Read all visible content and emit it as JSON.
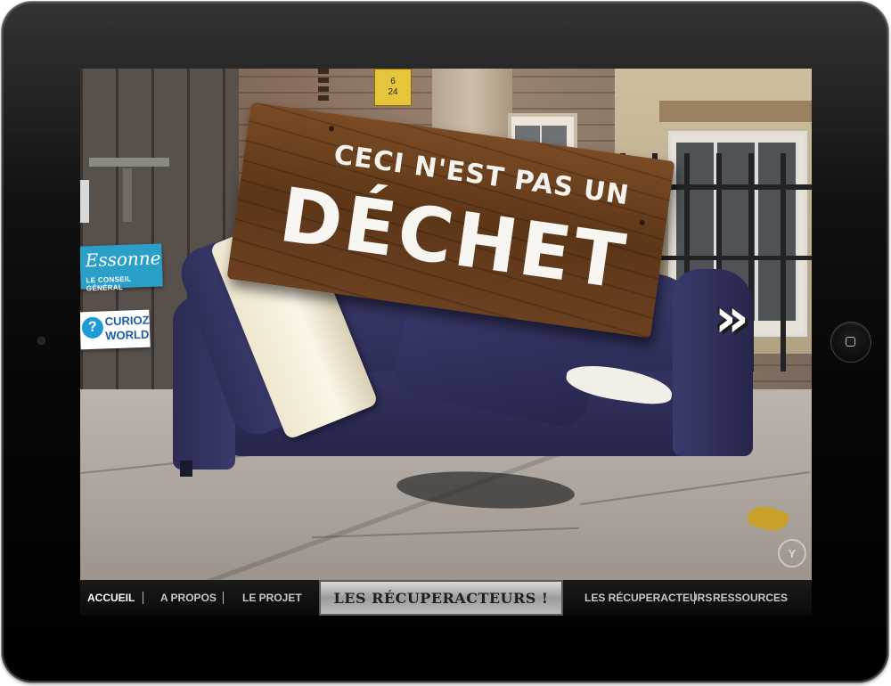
{
  "sign": {
    "line1": "CECI N'EST PAS UN",
    "line2": "DÉCHET"
  },
  "address_numbers": [
    "6",
    "24"
  ],
  "logos": {
    "essonne_script": "Essonne",
    "essonne_sub": "LE CONSEIL GÉNÉRAL",
    "curioz_badge": "?",
    "curioz_line1": "CURIOZ",
    "curioz_line2": "WORLD"
  },
  "watermark": "Y",
  "next_arrows": "»",
  "nav": {
    "items": [
      {
        "label": "ACCUEIL",
        "active": true
      },
      {
        "label": "A PROPOS",
        "active": false
      },
      {
        "label": "LE PROJET",
        "active": false
      },
      {
        "label": "LES RÉCUPERACTEURS !",
        "active": false
      },
      {
        "label": "LES RÉCUPERACTEURS",
        "active": false
      },
      {
        "label": "RESSOURCES",
        "active": false
      }
    ]
  }
}
